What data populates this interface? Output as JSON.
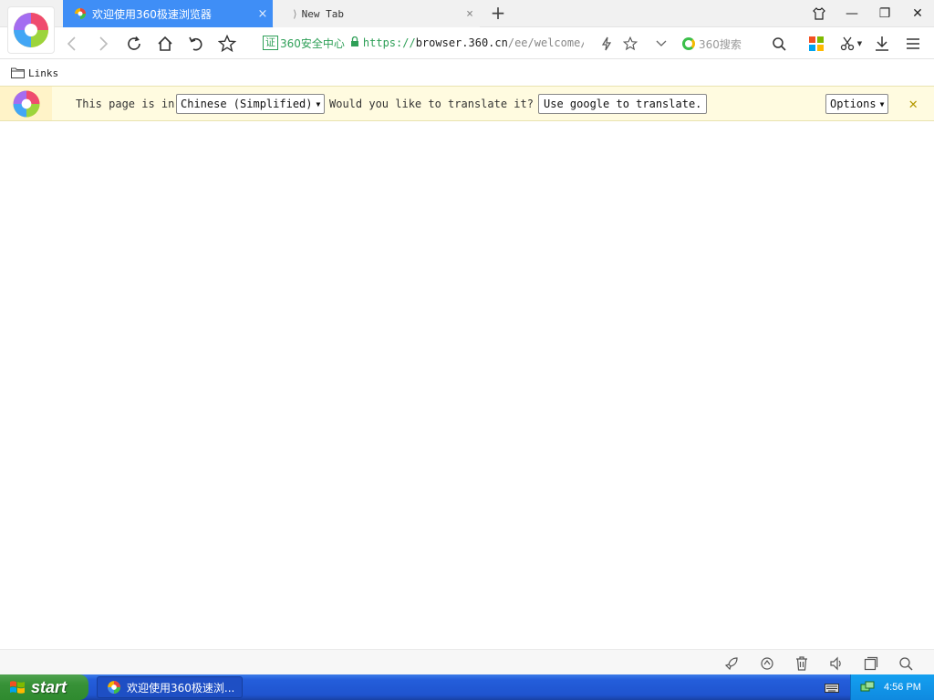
{
  "tabs": [
    {
      "title": "欢迎使用360极速浏览器",
      "close": "×",
      "active": true
    },
    {
      "title": "New Tab",
      "close": "×",
      "active": false
    }
  ],
  "new_tab_label": "+",
  "window_buttons": {
    "shirt": "skin-icon",
    "minimize": "—",
    "restore": "❐",
    "close": "✕"
  },
  "address_bar": {
    "cert_badge": "证",
    "cert_name": "360安全中心",
    "url_scheme": "https://",
    "url_host": "browser.360.cn",
    "url_path": "/ee/welcome/",
    "search_placeholder": "360搜索"
  },
  "bookmarks": {
    "items": [
      {
        "label": "Links"
      }
    ]
  },
  "translate_bar": {
    "prefix": "This page is in",
    "language": "Chinese (Simplified)",
    "question": "Would you like to translate it?",
    "translate_button": "Use google to translate.",
    "options_button": "Options",
    "close": "✕"
  },
  "taskbar": {
    "start_label": "start",
    "task_label": "欢迎使用360极速浏...",
    "clock": "4:56 PM"
  },
  "colors": {
    "tab_active": "#3f8ef6",
    "cert_green": "#2e9f57",
    "infobar_bg": "#fffbe0",
    "taskbar_blue": "#245edb",
    "start_green": "#379137"
  }
}
